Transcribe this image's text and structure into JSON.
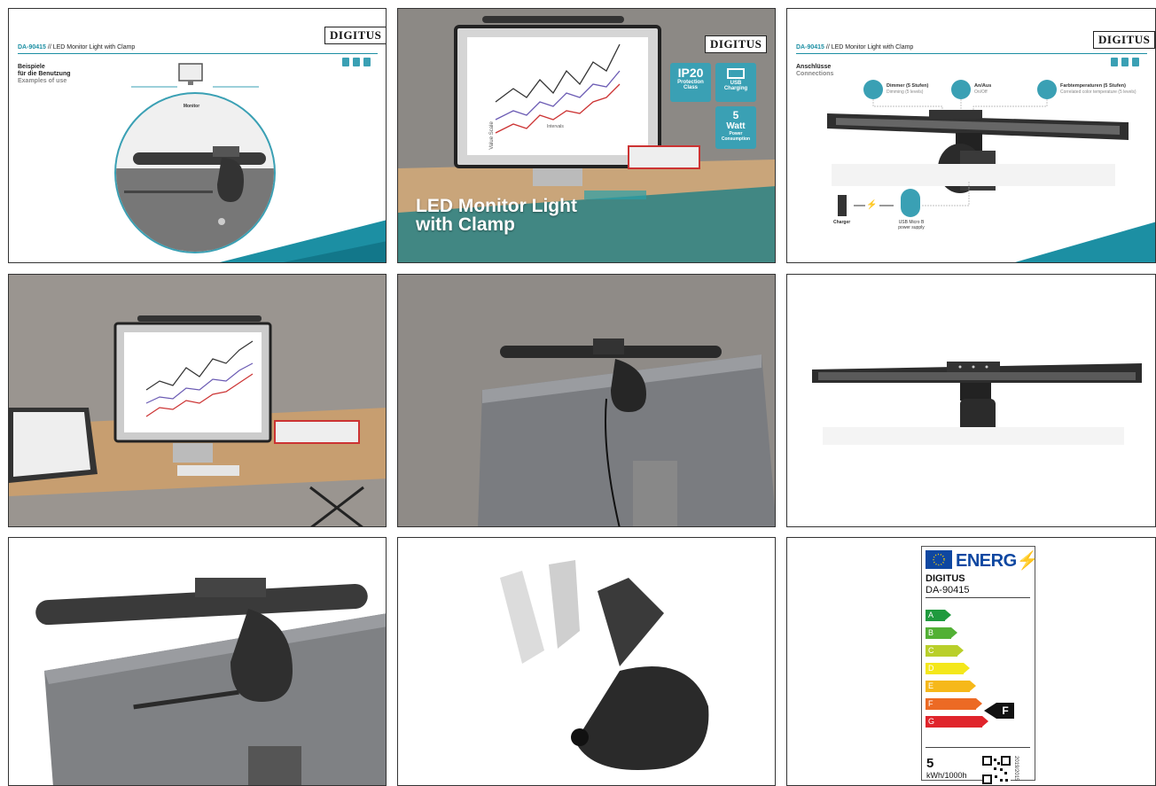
{
  "tile1": {
    "product_code": "DA-90415",
    "separator": "//",
    "product_name": "LED Monitor Light with Clamp",
    "brand": "DIGITUS",
    "heading_de_1": "Beispiele",
    "heading_de_2": "für die Benutzung",
    "heading_en": "Examples of use",
    "monitor_label": "Monitor"
  },
  "tile2": {
    "brand": "DIGITUS",
    "title_line1": "LED Monitor Light",
    "title_line2": "with Clamp",
    "features": [
      {
        "big": "IP20",
        "line1": "Protection",
        "line2": "Class"
      },
      {
        "big": "",
        "line1": "USB",
        "line2": "Charging"
      },
      {
        "big": "5",
        "big2": "Watt",
        "line1": "Power",
        "line2": "Consumption"
      }
    ],
    "chart_ylabel": "Value Scale",
    "chart_xlabel": "Intervals"
  },
  "tile3": {
    "product_code": "DA-90415",
    "separator": "//",
    "product_name": "LED Monitor Light with Clamp",
    "brand": "DIGITUS",
    "heading_de": "Anschlüsse",
    "heading_en": "Connections",
    "controls": [
      {
        "title": "Dimmer (5 Stufen)",
        "sub": "Dimming (5 levels)"
      },
      {
        "title": "An/Aus",
        "sub": "On/Off"
      },
      {
        "title": "Farbtemperaturen (5 Stufen)",
        "sub": "Correlated color temperature (5 levels)"
      }
    ],
    "charger_label": "Charger",
    "usb_label_1": "USB Micro B",
    "usb_label_2": "power supply"
  },
  "tile9": {
    "energy_word": "ENERG",
    "brand": "DIGITUS",
    "model": "DA-90415",
    "classes": [
      "A",
      "B",
      "C",
      "D",
      "E",
      "F",
      "G"
    ],
    "class_colors": [
      "#1f9a3e",
      "#52b035",
      "#b9cf2a",
      "#f4e71b",
      "#f6b81a",
      "#ec6a24",
      "#e0242b"
    ],
    "rating": "F",
    "kwh_value": "5",
    "kwh_unit": "kWh/1000h",
    "regulation": "2019/2015"
  }
}
